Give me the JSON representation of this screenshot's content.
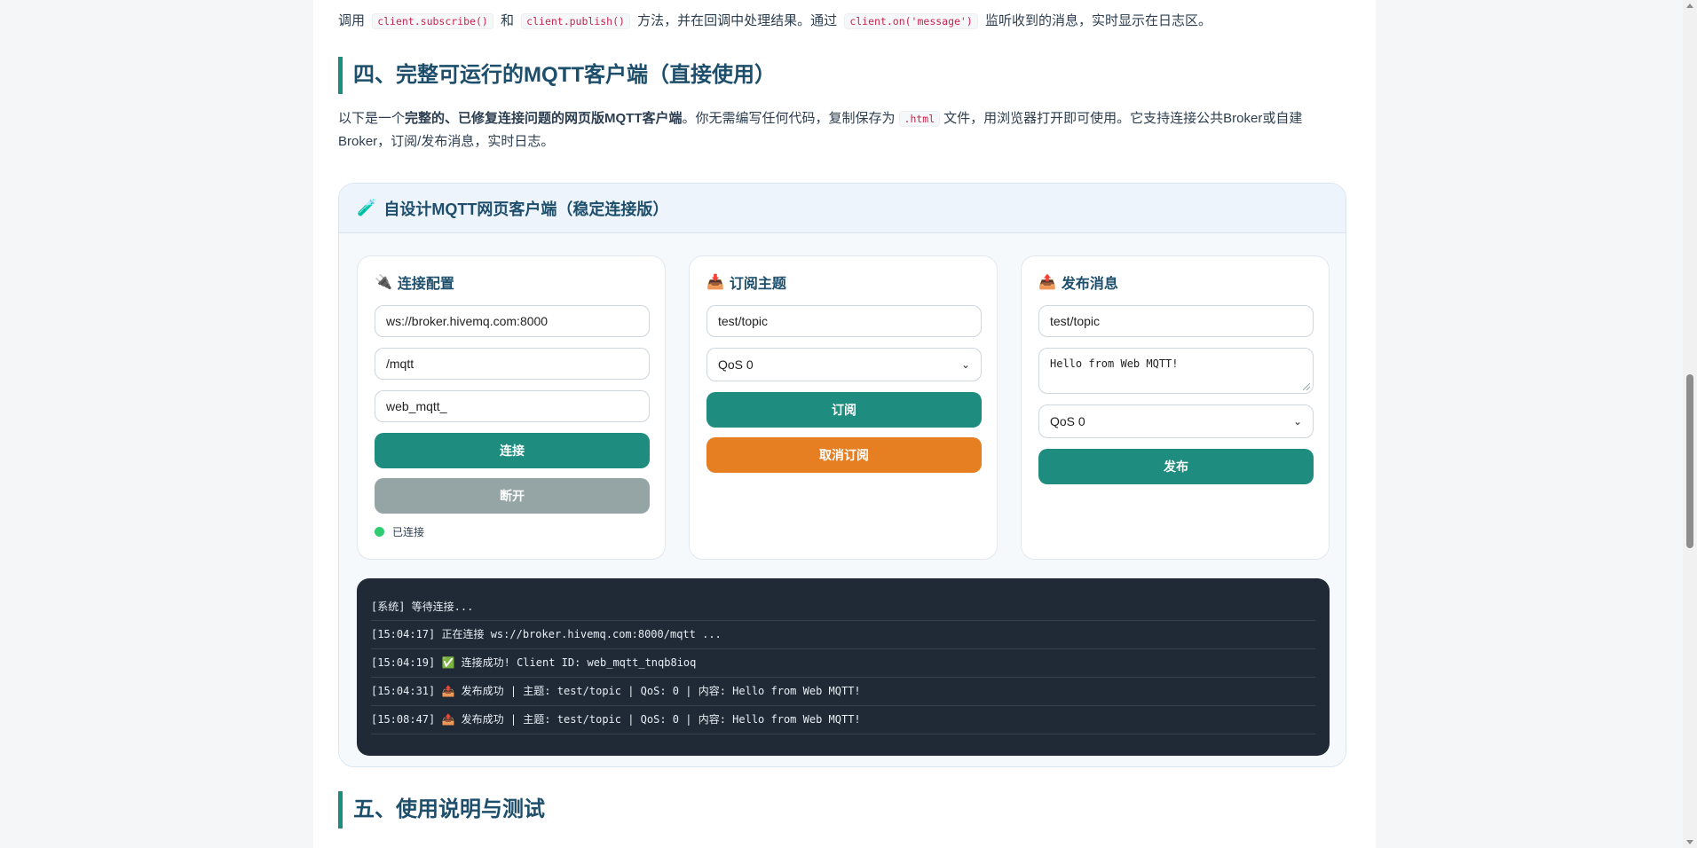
{
  "intro": {
    "prefix": "调用",
    "code1": "client.subscribe()",
    "and": "和",
    "code2": "client.publish()",
    "middle": "方法，并在回调中处理结果。通过",
    "code3": "client.on('message')",
    "suffix": "监听收到的消息，实时显示在日志区。"
  },
  "section4": {
    "heading": "四、完整可运行的MQTT客户端（直接使用）",
    "p_prefix": "以下是一个",
    "p_bold": "完整的、已修复连接问题的网页版MQTT客户端",
    "p_mid": "。你无需编写任何代码，复制保存为",
    "p_code": ".html",
    "p_suffix": "文件，用浏览器打开即可使用。它支持连接公共Broker或自建Broker，订阅/发布消息，实时日志。"
  },
  "client": {
    "title": "自设计MQTT网页客户端（稳定连接版）",
    "title_icon": "test-tube-icon",
    "connect": {
      "title": "连接配置",
      "icon": "plug-icon",
      "host": "ws://broker.hivemq.com:8000",
      "path": "/mqtt",
      "client_id": "web_mqtt_",
      "connect_label": "连接",
      "disconnect_label": "断开",
      "status": "已连接",
      "status_color": "#2ecc71"
    },
    "subscribe": {
      "title": "订阅主题",
      "icon": "inbox-tray-icon",
      "topic": "test/topic",
      "qos": "QoS 0",
      "subscribe_label": "订阅",
      "unsubscribe_label": "取消订阅"
    },
    "publish": {
      "title": "发布消息",
      "icon": "outbox-tray-icon",
      "topic": "test/topic",
      "message": "Hello from Web MQTT!",
      "qos": "QoS 0",
      "publish_label": "发布"
    },
    "log": [
      "[系统] 等待连接...",
      "[15:04:17] 正在连接 ws://broker.hivemq.com:8000/mqtt ...",
      "[15:04:19] ✅ 连接成功! Client ID: web_mqtt_tnqb8ioq",
      "[15:04:31] 📤 发布成功 | 主题: test/topic | QoS: 0 | 内容: Hello from Web MQTT!",
      "[15:08:47] 📤 发布成功 | 主题: test/topic | QoS: 0 | 内容: Hello from Web MQTT!"
    ]
  },
  "section5": {
    "heading": "五、使用说明与测试"
  },
  "colors": {
    "accent": "#1e8c7e",
    "orange": "#e67e22",
    "gray": "#95a5a6",
    "log_bg": "#1f2a36"
  }
}
